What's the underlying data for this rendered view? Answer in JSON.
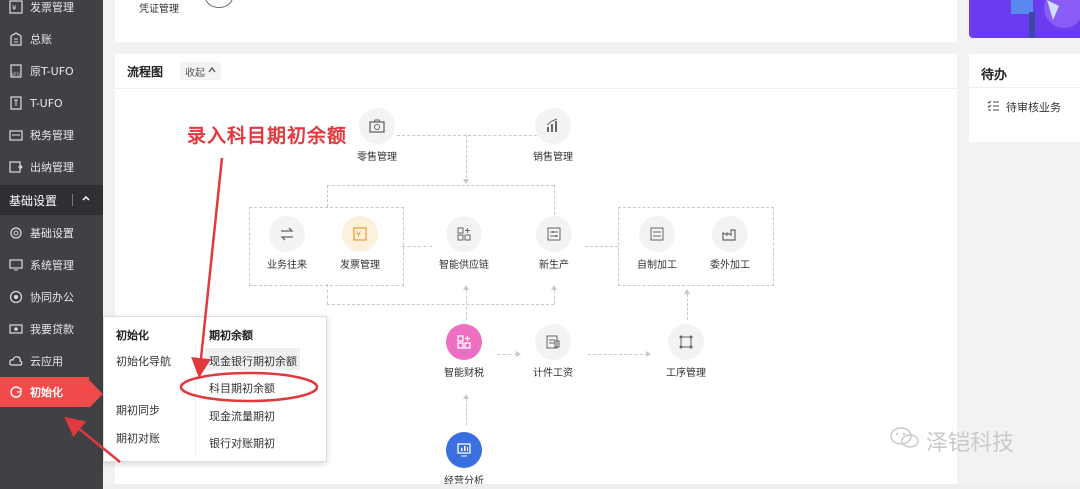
{
  "sidebar": {
    "items": [
      {
        "label": "发票管理",
        "icon": "invoice-icon"
      },
      {
        "label": "总账",
        "icon": "ledger-icon"
      },
      {
        "label": "原T-UFO",
        "icon": "ufo-icon"
      },
      {
        "label": "T-UFO",
        "icon": "tufo-icon"
      },
      {
        "label": "税务管理",
        "icon": "tax-icon"
      },
      {
        "label": "出纳管理",
        "icon": "cashier-icon"
      }
    ],
    "section": {
      "label": "基础设置"
    },
    "items2": [
      {
        "label": "基础设置",
        "icon": "settings-icon"
      },
      {
        "label": "系统管理",
        "icon": "monitor-icon"
      },
      {
        "label": "协同办公",
        "icon": "collab-icon"
      },
      {
        "label": "我要贷款",
        "icon": "loan-icon"
      },
      {
        "label": "云应用",
        "icon": "cloud-icon"
      },
      {
        "label": "初始化",
        "icon": "init-icon"
      }
    ]
  },
  "top": {
    "voucher_label": "凭证管理"
  },
  "flow": {
    "title": "流程图",
    "collapse": "收起",
    "nodes": {
      "retail": "零售管理",
      "sales": "销售管理",
      "business": "业务往来",
      "invoice": "发票管理",
      "supply": "智能供应链",
      "newprod": "新生产",
      "selfproc": "自制加工",
      "outsource": "委外加工",
      "tax": "智能财税",
      "wage": "计件工资",
      "process": "工序管理",
      "analysis": "经营分析"
    }
  },
  "annotation": "录入科目期初余额",
  "popup": {
    "col1_title": "初始化",
    "col1_items": [
      "初始化导航",
      "期初同步",
      "期初对账"
    ],
    "col2_title": "期初余额",
    "col2_items": [
      "现金银行期初余额",
      "科目期初余额",
      "现金流量期初",
      "银行对账期初"
    ]
  },
  "todo": {
    "title": "待办",
    "item": "待审核业务"
  },
  "watermark": "泽铠科技",
  "colors": {
    "accent": "#f04a4a",
    "sidebar": "#3f4145",
    "annotation": "#e0393e"
  }
}
